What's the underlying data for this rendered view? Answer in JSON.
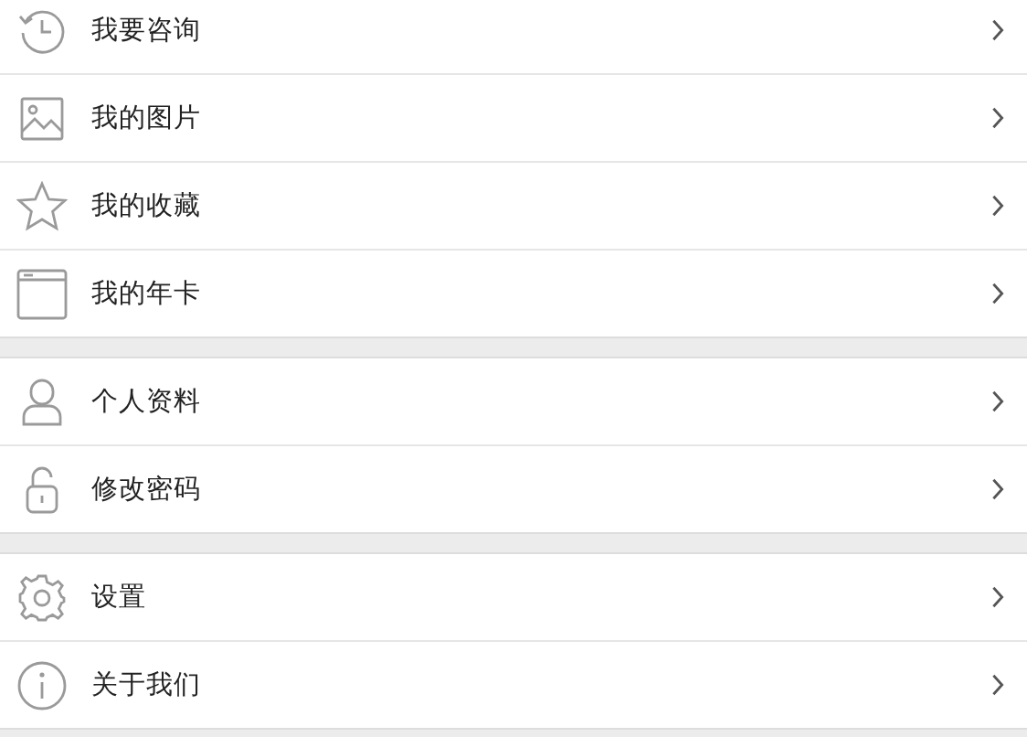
{
  "groups": [
    {
      "items": [
        {
          "label": "我要咨询"
        },
        {
          "label": "我的图片"
        },
        {
          "label": "我的收藏"
        },
        {
          "label": "我的年卡"
        }
      ]
    },
    {
      "items": [
        {
          "label": "个人资料"
        },
        {
          "label": "修改密码"
        }
      ]
    },
    {
      "items": [
        {
          "label": "设置"
        },
        {
          "label": "关于我们"
        }
      ]
    }
  ]
}
